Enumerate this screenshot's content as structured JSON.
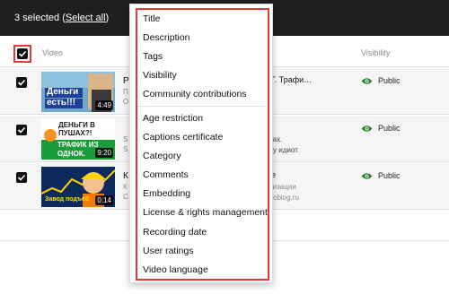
{
  "selection": {
    "count_text": "3 selected",
    "open_paren": " (",
    "select_all": "Select all",
    "close_paren": ")"
  },
  "header": {
    "video_label": "Video",
    "visibility_label": "Visibility"
  },
  "menu": {
    "group1": [
      "Title",
      "Description",
      "Tags",
      "Visibility",
      "Community contributions"
    ],
    "group2": [
      "Age restriction",
      "Captions certificate",
      "Category",
      "Comments",
      "Embedding",
      "License & rights management",
      "Recording date",
      "User ratings",
      "Video language"
    ]
  },
  "rows": [
    {
      "title_initial": "Р",
      "title_fragment": "Г. Трафи…",
      "desc_fragment": "",
      "desc_fragment2": "",
      "sub1": "П",
      "sub2": "О",
      "thumb_text1": "Деньги",
      "thumb_text2": "есть!!!",
      "duration": "4:49",
      "visibility": "Public"
    },
    {
      "title_initial": "",
      "title_fragment": "",
      "desc_fragment": "ках.",
      "desc_fragment2": "ху идиот.",
      "sub1": "S",
      "sub2": "S",
      "thumb_text1": "ДЕНЬГИ В",
      "thumb_text2": "ПУШАХ?!",
      "thumb_text3": "ТРАФИК ИЗ",
      "thumb_text4": "ОДНОК.",
      "duration": "9:20",
      "visibility": "Public"
    },
    {
      "title_initial": "К",
      "title_fragment": "е",
      "desc_fragment": "тизации",
      "desc_fragment2": "koblog.ru",
      "sub1": "К",
      "sub2": "С",
      "thumb_text1": "Завод подъеб",
      "duration": "0:14",
      "visibility": "Public"
    }
  ],
  "colors": {
    "highlight": "#e53935",
    "public_eye": "#2e7d32",
    "bar": "#1f1f1f",
    "row_bg": "#f5f5f5"
  }
}
